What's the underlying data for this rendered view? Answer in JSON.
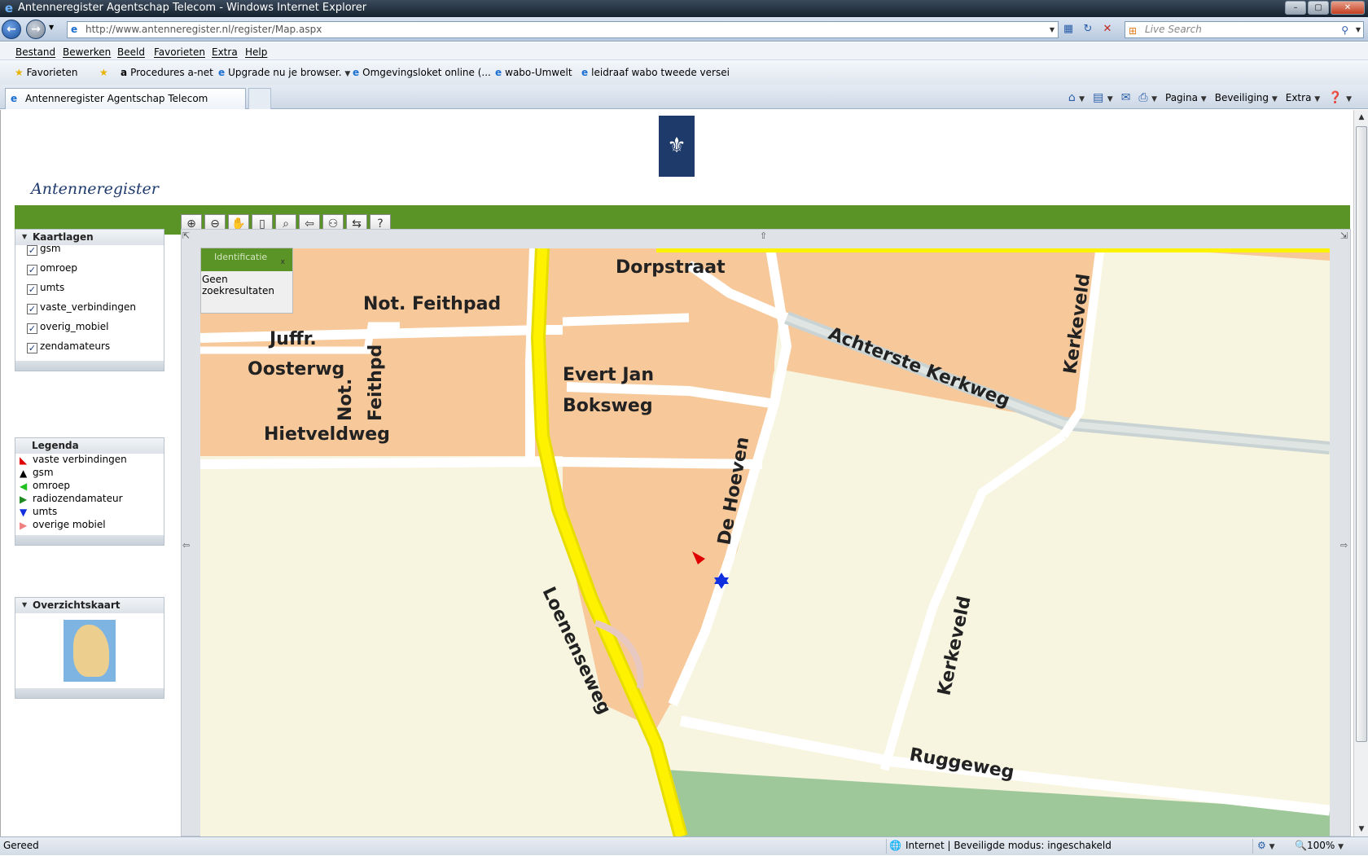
{
  "window": {
    "title": "Antenneregister Agentschap Telecom - Windows Internet Explorer"
  },
  "address": {
    "url": "http://www.antenneregister.nl/register/Map.aspx",
    "search_placeholder": "Live Search"
  },
  "menu": [
    "Bestand",
    "Bewerken",
    "Beeld",
    "Favorieten",
    "Extra",
    "Help"
  ],
  "favorites": {
    "label": "Favorieten",
    "items": [
      "Procedures  a-net",
      "Upgrade nu je browser.",
      "Omgevingsloket online (...",
      "wabo-Umwelt",
      "leidraaf wabo tweede versei"
    ]
  },
  "tab": {
    "title": "Antenneregister Agentschap Telecom"
  },
  "commandbar": {
    "page": "Pagina",
    "security": "Beveiliging",
    "extra": "Extra"
  },
  "site": {
    "brand": "Antenneregister"
  },
  "layers_panel": {
    "title": "Kaartlagen",
    "layers": [
      "gsm",
      "omroep",
      "umts",
      "vaste_verbindingen",
      "overig_mobiel",
      "zendamateurs"
    ]
  },
  "legend_panel": {
    "title": "Legenda",
    "items": [
      {
        "label": "vaste verbindingen",
        "color": "#e00000",
        "icon": "triangle-down-left-icon"
      },
      {
        "label": "gsm",
        "color": "#000000",
        "icon": "triangle-up-icon"
      },
      {
        "label": "omroep",
        "color": "#20c020",
        "icon": "triangle-left-icon"
      },
      {
        "label": "radiozendamateur",
        "color": "#1f8a1f",
        "icon": "triangle-right-icon"
      },
      {
        "label": "umts",
        "color": "#1030e0",
        "icon": "triangle-down-icon"
      },
      {
        "label": "overige mobiel",
        "color": "#f08080",
        "icon": "triangle-right-icon"
      }
    ]
  },
  "overview_panel": {
    "title": "Overzichtskaart"
  },
  "identification": {
    "title": "Identificatie",
    "close": "x",
    "message": "Geen zoekresultaten"
  },
  "map": {
    "streets": [
      "Dorpstraat",
      "Not. Feithpad",
      "Juffr.",
      "Oosterwg",
      "Not.",
      "Feithpd",
      "Evert  Jan",
      "Boksweg",
      "Hietveldweg",
      "Achterste  Kerkweg",
      "Kerkeveld",
      "De  Hoeven",
      "Loenenseweg",
      "Kerkeveld",
      "Ruggeweg"
    ]
  },
  "status": {
    "left": "Gereed",
    "zone": "Internet | Beveiligde modus: ingeschakeld",
    "zoom": "100%"
  }
}
